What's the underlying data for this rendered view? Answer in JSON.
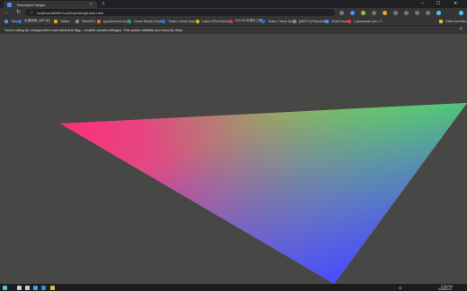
{
  "browser": {
    "tab_title": "Descriptor Heaps",
    "tab_close": "×",
    "new_tab": "+",
    "window_controls": [
      "–",
      "☐",
      "✕"
    ],
    "url": "localhost:8080/YouNG/public/gfx/test.html",
    "url_icon": "ⓘ",
    "nav": {
      "back": "←",
      "forward": "→",
      "reload": "↻"
    }
  },
  "bookmarks": [
    {
      "label": "Tabs",
      "color": "#4a8df8"
    },
    {
      "label": "百度搜索 (360°@)",
      "color": "#2f6fe0"
    },
    {
      "label": "Twitter",
      "color": "#e8a72e"
    },
    {
      "label": "WebGPU",
      "color": "#888888"
    },
    {
      "label": "typedfemeno.com",
      "color": "#e06c2e"
    },
    {
      "label": "Game Ready Shots...",
      "color": "#3a9d5d"
    },
    {
      "label": "Tsdlcn Crtsde Anal...",
      "color": "#2d6fd6"
    },
    {
      "label": "Latest KRs/Tsdlsnt's...",
      "color": "#d6b02d"
    },
    {
      "label": "DCCM 可视化工具...",
      "color": "#c73d3d"
    },
    {
      "label": "Tsdlcn Crtsde Anal...",
      "color": "#2d6fd6"
    },
    {
      "label": "[WIKTO] PhysicsBs...",
      "color": "#888888"
    },
    {
      "label": "ShadConnect",
      "color": "#4a8df8"
    },
    {
      "label": "c.ghosdestr.com / F...",
      "color": "#d23c3c"
    },
    {
      "label": "Other favorites",
      "color": "#e8b83a"
    }
  ],
  "infobar": {
    "message": "You're using an unsupported command-line flag: --enable-unsafe-webgpu. This poses stability and security risks.",
    "close": "×"
  },
  "extensions": [
    {
      "color": "#777777"
    },
    {
      "color": "#4a8df8"
    },
    {
      "color": "#8cc34a"
    },
    {
      "color": "#777777"
    },
    {
      "color": "#e8a72e"
    },
    {
      "color": "#777777"
    },
    {
      "color": "#777777"
    },
    {
      "color": "#777777"
    },
    {
      "color": "#777777"
    },
    {
      "color": "#4fc3f7"
    }
  ],
  "taskbar": {
    "icons": [
      {
        "name": "start-icon",
        "color": "#4fc3f7"
      },
      {
        "name": "search-icon",
        "color": "#cccccc"
      },
      {
        "name": "task-view-icon",
        "color": "#cccccc"
      },
      {
        "name": "edge-icon",
        "color": "#35a9e0"
      },
      {
        "name": "vscode-icon",
        "color": "#2b8ee8"
      },
      {
        "name": "explorer-icon",
        "color": "#e8b83a"
      }
    ],
    "language": "中",
    "time": "2:36 PM",
    "date": "4/28/2021"
  },
  "scene": {
    "background": "#474745",
    "vertex_colors": [
      "#ff2e7a",
      "#52ff3b",
      "#4a4aff"
    ]
  }
}
